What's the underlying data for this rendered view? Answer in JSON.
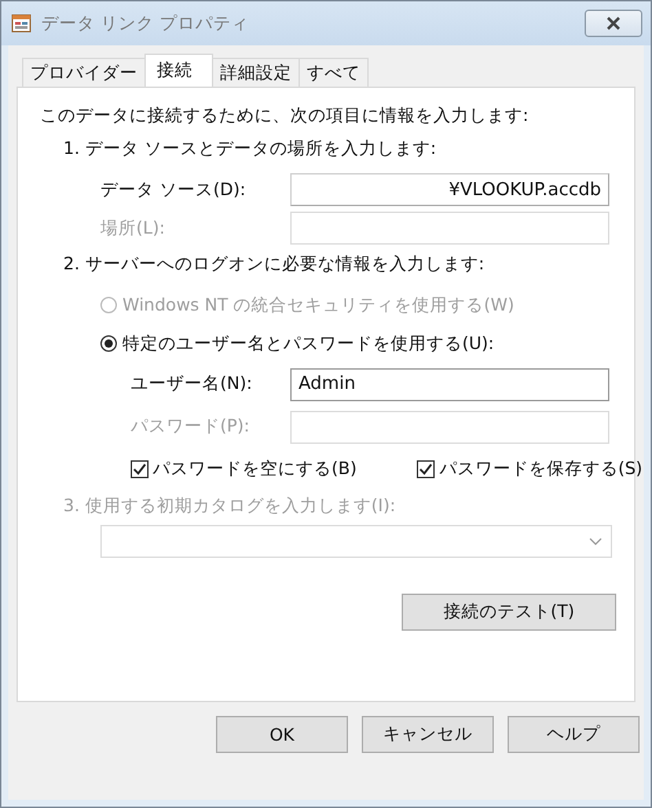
{
  "window": {
    "title": "データ リンク プロパティ"
  },
  "tabs": [
    {
      "label": "プロバイダー",
      "selected": false
    },
    {
      "label": "接続",
      "selected": true
    },
    {
      "label": "詳細設定",
      "selected": false
    },
    {
      "label": "すべて",
      "selected": false
    }
  ],
  "intro": "このデータに接続するために、次の項目に情報を入力します:",
  "section_1": {
    "heading": "1. データ ソースとデータの場所を入力します:",
    "fields": [
      {
        "label": "データ ソース(D):",
        "value": "¥VLOOKUP.accdb",
        "disabled": false
      },
      {
        "label": "場所(L):",
        "disabled": true
      }
    ]
  },
  "section_2": {
    "heading": "2. サーバーへのログオンに必要な情報を入力します:",
    "options": [
      {
        "label": "Windows NT の統合セキュリティを使用する(W)",
        "selected": false,
        "disabled": true
      },
      {
        "label": "特定のユーザー名とパスワードを使用する(U):",
        "selected": true,
        "disabled": false
      }
    ],
    "fields": [
      {
        "label": "ユーザー名(N):",
        "value": "Admin",
        "disabled": false
      },
      {
        "label": "パスワード(P):",
        "disabled": true
      }
    ],
    "checkboxes": [
      {
        "label": "パスワードを空にする(B)",
        "checked": true
      },
      {
        "label": "パスワードを保存する(S)",
        "checked": true
      }
    ]
  },
  "section_3": {
    "heading": "3. 使用する初期カタログを入力します(I):",
    "disabled": true
  },
  "test_button": "接続のテスト(T)",
  "buttons": [
    "OK",
    "キャンセル",
    "ヘルプ"
  ]
}
